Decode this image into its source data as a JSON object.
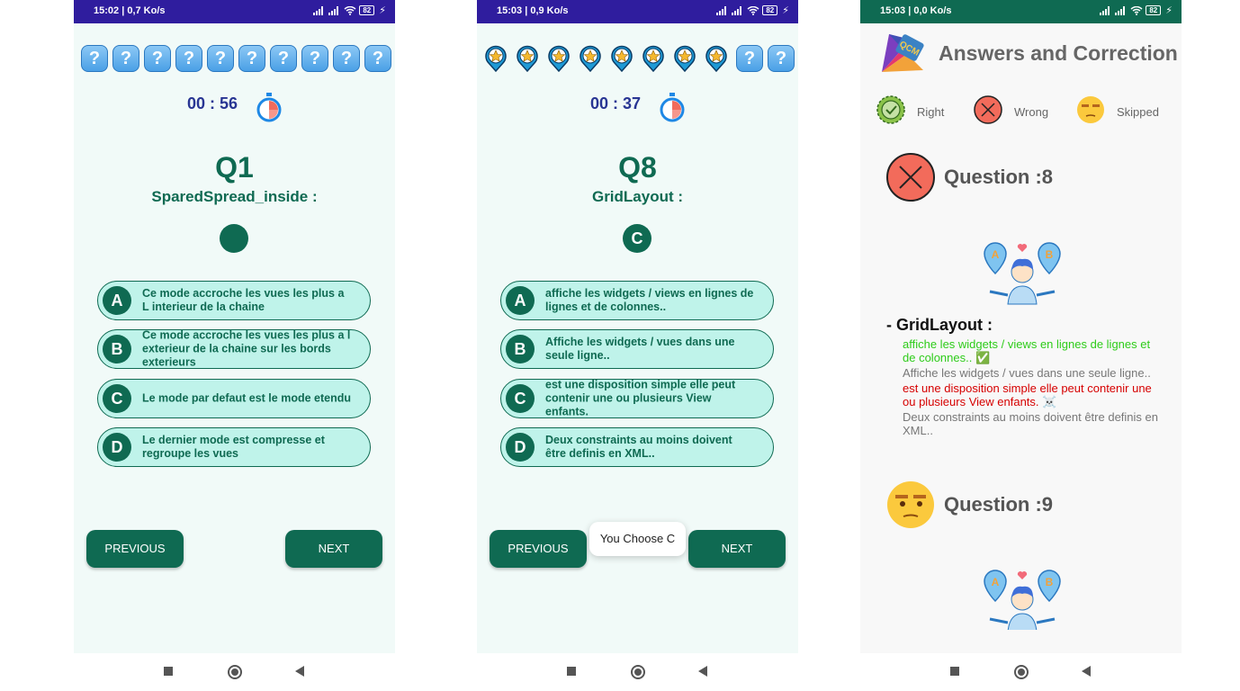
{
  "phones": [
    {
      "status": {
        "time": "15:02 | 0,7 Ko/s",
        "battery": "82"
      },
      "timer": "00 : 56",
      "question_number": "Q1",
      "question_title": "SparedSpread_inside :",
      "selected_choice": "",
      "progress_icons": [
        "?",
        "?",
        "?",
        "?",
        "?",
        "?",
        "?",
        "?",
        "?",
        "?"
      ],
      "options": [
        {
          "letter": "A",
          "text": "Ce mode accroche les vues les plus a L interieur de la chaine"
        },
        {
          "letter": "B",
          "text": "Ce mode accroche les vues les plus a l exterieur de la chaine sur les bords exterieurs"
        },
        {
          "letter": "C",
          "text": "Le mode par defaut est le mode etendu"
        },
        {
          "letter": "D",
          "text": "Le dernier mode est compresse et regroupe les vues"
        }
      ],
      "prev_label": "PREVIOUS",
      "next_label": "NEXT"
    },
    {
      "status": {
        "time": "15:03 | 0,9 Ko/s",
        "battery": "82"
      },
      "timer": "00 : 37",
      "question_number": "Q8",
      "question_title": "GridLayout :",
      "selected_choice": "C",
      "progress_icons": [
        "star",
        "star",
        "star",
        "star",
        "star",
        "star",
        "star",
        "star",
        "?",
        "?"
      ],
      "options": [
        {
          "letter": "A",
          "text": "affiche les widgets / views en lignes de lignes et de colonnes.."
        },
        {
          "letter": "B",
          "text": "Affiche les widgets / vues dans une seule ligne.."
        },
        {
          "letter": "C",
          "text": "est une disposition simple elle peut contenir une ou plusieurs View enfants."
        },
        {
          "letter": "D",
          "text": "Deux constraints au moins doivent être definis en XML.."
        }
      ],
      "toast": "You Choose C",
      "prev_label": "PREVIOUS",
      "next_label": "NEXT"
    }
  ],
  "correction": {
    "status": {
      "time": "15:03 | 0,0 Ko/s",
      "battery": "82"
    },
    "logo_text": "QCM",
    "title": "Answers and Correction",
    "legend": [
      {
        "label": "Right",
        "icon": "check-badge-icon"
      },
      {
        "label": "Wrong",
        "icon": "cross-circle-icon"
      },
      {
        "label": "Skipped",
        "icon": "unamused-face-icon"
      }
    ],
    "questions": [
      {
        "label": "Question   :8",
        "status": "wrong"
      },
      {
        "label": "Question   :9",
        "status": "skipped"
      }
    ],
    "answer_title": "- GridLayout :",
    "answers": [
      {
        "text": "affiche les widgets / views en lignes de lignes et de colonnes..",
        "mark": "✅",
        "color": "#2ecc1a"
      },
      {
        "text": "Affiche les widgets / vues dans une seule ligne..",
        "mark": "",
        "color": "#777777"
      },
      {
        "text": "est une disposition simple elle peut contenir une ou plusieurs View enfants.",
        "mark": "☠️",
        "color": "#d60000"
      },
      {
        "text": "Deux constraints au moins doivent être definis en XML..",
        "mark": "",
        "color": "#777777"
      }
    ]
  },
  "colors": {
    "primary": "#0f6a52",
    "option_bg": "#bff3ea",
    "timer": "#283593",
    "statusbar_quiz": "#2f1d9e"
  }
}
